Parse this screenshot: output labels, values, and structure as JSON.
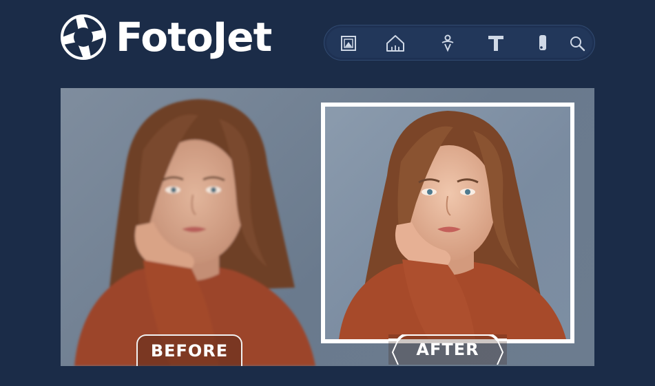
{
  "brand": {
    "name": "FotoJet"
  },
  "toolbar": {
    "tools": [
      {
        "icon": "image-frame-icon"
      },
      {
        "icon": "house-icon"
      },
      {
        "icon": "person-icon"
      },
      {
        "icon": "text-icon"
      },
      {
        "icon": "eraser-icon"
      },
      {
        "icon": "search-icon"
      }
    ]
  },
  "comparison": {
    "before_label": "BEFORE",
    "after_label": "AFTER"
  },
  "colors": {
    "background": "#1b2c48",
    "toolbar": "#22375a",
    "sweater": "#a34a2c",
    "hair": "#6e4128",
    "frame": "#ffffff"
  }
}
